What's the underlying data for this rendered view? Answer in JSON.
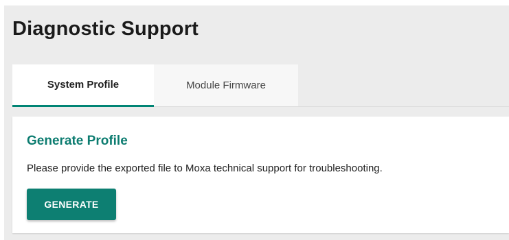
{
  "page": {
    "title": "Diagnostic Support"
  },
  "tabs": [
    {
      "label": "System Profile",
      "active": true
    },
    {
      "label": "Module Firmware",
      "active": false
    }
  ],
  "card": {
    "title": "Generate Profile",
    "description": "Please provide the exported file to Moxa technical support for troubleshooting.",
    "button_label": "GENERATE"
  },
  "colors": {
    "accent": "#0d7f72",
    "page_background": "#ececec",
    "card_background": "#ffffff"
  }
}
